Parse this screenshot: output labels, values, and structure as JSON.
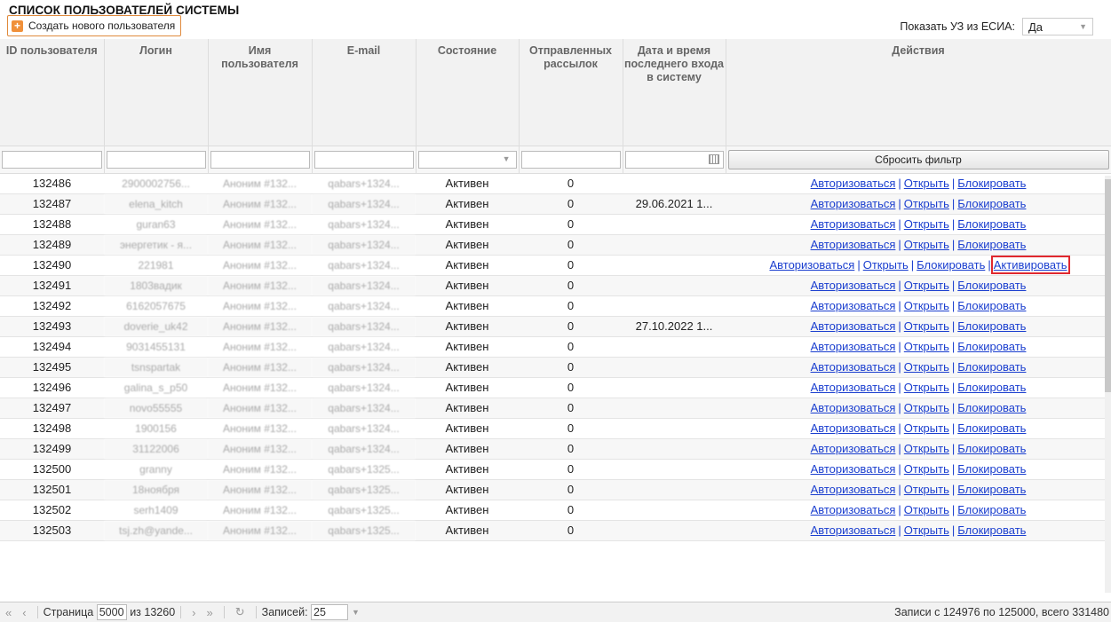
{
  "title": "СПИСОК ПОЛЬЗОВАТЕЛЕЙ СИСТЕМЫ",
  "create_button": "Создать нового пользователя",
  "esia": {
    "label": "Показать УЗ из ЕСИА:",
    "value": "Да"
  },
  "columns": [
    "ID пользователя",
    "Логин",
    "Имя пользователя",
    "E-mail",
    "Состояние",
    "Отправленных рассылок",
    "Дата и время последнего входа в систему",
    "Действия"
  ],
  "reset_filter": "Сбросить фильтр",
  "actions": {
    "login": "Авторизоваться",
    "open": "Открыть",
    "block": "Блокировать",
    "activate": "Активировать"
  },
  "rows": [
    {
      "id": "132486",
      "login": "2900002756...",
      "name": "Аноним #132...",
      "email": "qabars+1324...",
      "state": "Активен",
      "sent": "0",
      "date": ""
    },
    {
      "id": "132487",
      "login": "elena_kitch",
      "name": "Аноним #132...",
      "email": "qabars+1324...",
      "state": "Активен",
      "sent": "0",
      "date": "29.06.2021 1..."
    },
    {
      "id": "132488",
      "login": "guran63",
      "name": "Аноним #132...",
      "email": "qabars+1324...",
      "state": "Активен",
      "sent": "0",
      "date": ""
    },
    {
      "id": "132489",
      "login": "энергетик - я...",
      "name": "Аноним #132...",
      "email": "qabars+1324...",
      "state": "Активен",
      "sent": "0",
      "date": ""
    },
    {
      "id": "132490",
      "login": "221981",
      "name": "Аноним #132...",
      "email": "qabars+1324...",
      "state": "Активен",
      "sent": "0",
      "date": "",
      "activate": true
    },
    {
      "id": "132491",
      "login": "1803вадик",
      "name": "Аноним #132...",
      "email": "qabars+1324...",
      "state": "Активен",
      "sent": "0",
      "date": ""
    },
    {
      "id": "132492",
      "login": "6162057675",
      "name": "Аноним #132...",
      "email": "qabars+1324...",
      "state": "Активен",
      "sent": "0",
      "date": ""
    },
    {
      "id": "132493",
      "login": "doverie_uk42",
      "name": "Аноним #132...",
      "email": "qabars+1324...",
      "state": "Активен",
      "sent": "0",
      "date": "27.10.2022 1..."
    },
    {
      "id": "132494",
      "login": "9031455131",
      "name": "Аноним #132...",
      "email": "qabars+1324...",
      "state": "Активен",
      "sent": "0",
      "date": ""
    },
    {
      "id": "132495",
      "login": "tsnspartak",
      "name": "Аноним #132...",
      "email": "qabars+1324...",
      "state": "Активен",
      "sent": "0",
      "date": ""
    },
    {
      "id": "132496",
      "login": "galina_s_p50",
      "name": "Аноним #132...",
      "email": "qabars+1324...",
      "state": "Активен",
      "sent": "0",
      "date": ""
    },
    {
      "id": "132497",
      "login": "novo55555",
      "name": "Аноним #132...",
      "email": "qabars+1324...",
      "state": "Активен",
      "sent": "0",
      "date": ""
    },
    {
      "id": "132498",
      "login": "1900156",
      "name": "Аноним #132...",
      "email": "qabars+1324...",
      "state": "Активен",
      "sent": "0",
      "date": ""
    },
    {
      "id": "132499",
      "login": "31122006",
      "name": "Аноним #132...",
      "email": "qabars+1324...",
      "state": "Активен",
      "sent": "0",
      "date": ""
    },
    {
      "id": "132500",
      "login": "granny",
      "name": "Аноним #132...",
      "email": "qabars+1325...",
      "state": "Активен",
      "sent": "0",
      "date": ""
    },
    {
      "id": "132501",
      "login": "18ноября",
      "name": "Аноним #132...",
      "email": "qabars+1325...",
      "state": "Активен",
      "sent": "0",
      "date": ""
    },
    {
      "id": "132502",
      "login": "serh1409",
      "name": "Аноним #132...",
      "email": "qabars+1325...",
      "state": "Активен",
      "sent": "0",
      "date": ""
    },
    {
      "id": "132503",
      "login": "tsj.zh@yande...",
      "name": "Аноним #132...",
      "email": "qabars+1325...",
      "state": "Активен",
      "sent": "0",
      "date": ""
    }
  ],
  "pager": {
    "page_label": "Страница",
    "page": "5000",
    "of": "из 13260",
    "records_label": "Записей:",
    "records": "25",
    "info": "Записи с 124976 по 125000, всего 331480"
  }
}
